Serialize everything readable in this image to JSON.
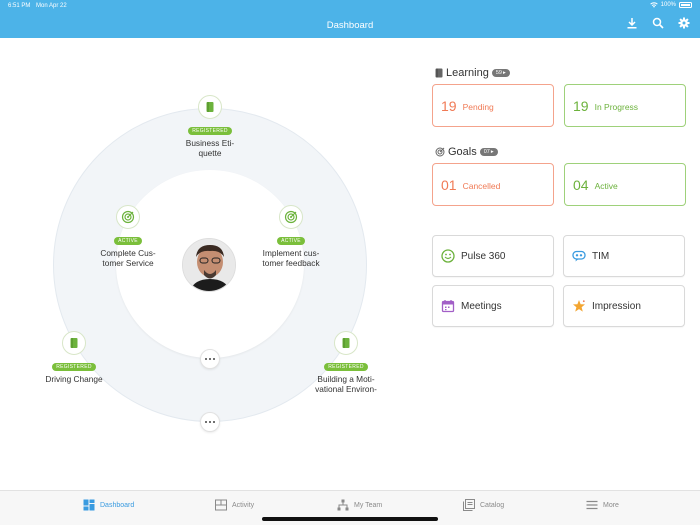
{
  "status": {
    "time": "6:51 PM",
    "date": "Mon Apr 22",
    "battery": "100%"
  },
  "nav": {
    "title": "Dashboard",
    "actions": [
      "download-icon",
      "search-icon",
      "gear-icon"
    ]
  },
  "colors": {
    "primary": "#4cb3e8",
    "orange": "#f07a55",
    "green": "#6cb23c",
    "badge_green": "#7bbf3b"
  },
  "goals_ring": {
    "nodes": [
      {
        "badge": "REGISTERED",
        "label_line1": "Business Eti-",
        "label_line2": "quette",
        "icon": "book-icon"
      },
      {
        "badge": "ACTIVE",
        "label_line1": "Complete Cus-",
        "label_line2": "tomer Service",
        "icon": "target-icon"
      },
      {
        "badge": "ACTIVE",
        "label_line1": "Implement cus-",
        "label_line2": "tomer feedback",
        "icon": "target-icon"
      },
      {
        "badge": "REGISTERED",
        "label_line1": "Driving Change",
        "label_line2": "",
        "icon": "book-icon"
      },
      {
        "badge": "REGISTERED",
        "label_line1": "Building a Moti-",
        "label_line2": "vational Environ-",
        "icon": "book-icon"
      }
    ]
  },
  "learning": {
    "title": "Learning",
    "count": "59",
    "stats": [
      {
        "value": "19",
        "label": "Pending"
      },
      {
        "value": "19",
        "label": "In Progress"
      }
    ]
  },
  "goals": {
    "title": "Goals",
    "count": "07",
    "stats": [
      {
        "value": "01",
        "label": "Cancelled"
      },
      {
        "value": "04",
        "label": "Active"
      }
    ]
  },
  "tiles": [
    {
      "label": "Pulse 360",
      "icon": "smiley-icon"
    },
    {
      "label": "TIM",
      "icon": "chat-icon"
    },
    {
      "label": "Meetings",
      "icon": "calendar-icon"
    },
    {
      "label": "Impression",
      "icon": "star-icon"
    }
  ],
  "tabs": [
    {
      "label": "Dashboard",
      "icon": "dashboard-icon",
      "active": true
    },
    {
      "label": "Activity",
      "icon": "activity-icon",
      "active": false
    },
    {
      "label": "My Team",
      "icon": "team-icon",
      "active": false
    },
    {
      "label": "Catalog",
      "icon": "catalog-icon",
      "active": false
    },
    {
      "label": "More",
      "icon": "menu-icon",
      "active": false
    }
  ]
}
